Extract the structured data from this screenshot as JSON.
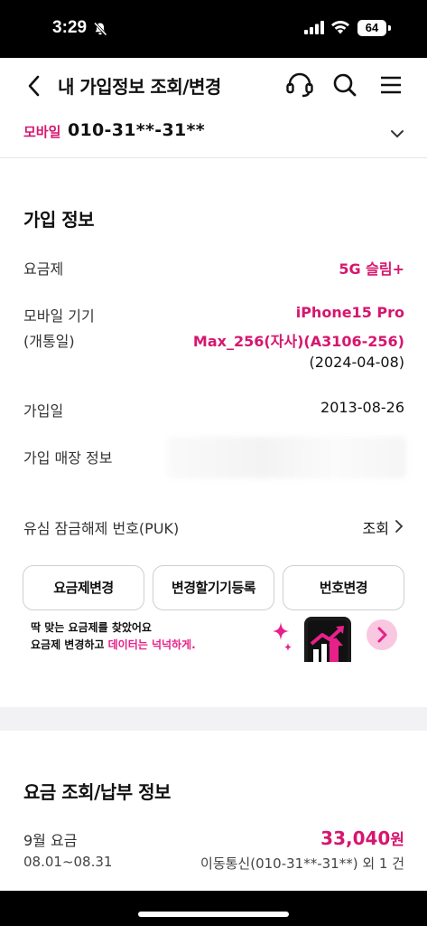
{
  "status": {
    "time": "3:29",
    "battery": "64"
  },
  "header": {
    "title": "내 가입정보 조회/변경"
  },
  "mobile_line": {
    "tag": "모바일",
    "number": "010-31**-31**"
  },
  "subscription": {
    "title": "가입 정보",
    "plan_label": "요금제",
    "plan_value": "5G 슬림+",
    "device_label_1": "모바일 기기",
    "device_label_2": "(개통일)",
    "device_value_1": "iPhone15 Pro",
    "device_value_2": "Max_256(자사)(A3106-256)",
    "device_date": "(2024-04-08)",
    "join_label": "가입일",
    "join_value": "2013-08-26",
    "store_label": "가입 매장 정보",
    "puk_label": "유심 잠금해제 번호(PUK)",
    "puk_action": "조회"
  },
  "buttons": {
    "plan_change": "요금제변경",
    "device_register": "변경할기기등록",
    "number_change": "번호변경"
  },
  "promo": {
    "line1": "딱 맞는 요금제를 찾았어요",
    "line2_prefix": "요금제 변경하고 ",
    "line2_highlight": "데이터는 넉넉하게."
  },
  "billing": {
    "title": "요금 조회/납부 정보",
    "month": "9월 요금",
    "period": "08.01~08.31",
    "amount": "33,040",
    "unit": "원",
    "line_info": "이동통신(010-31**-31**) 외 1 건"
  },
  "colors": {
    "accent": "#d6166f",
    "promo_button": "#f9c7e0"
  }
}
